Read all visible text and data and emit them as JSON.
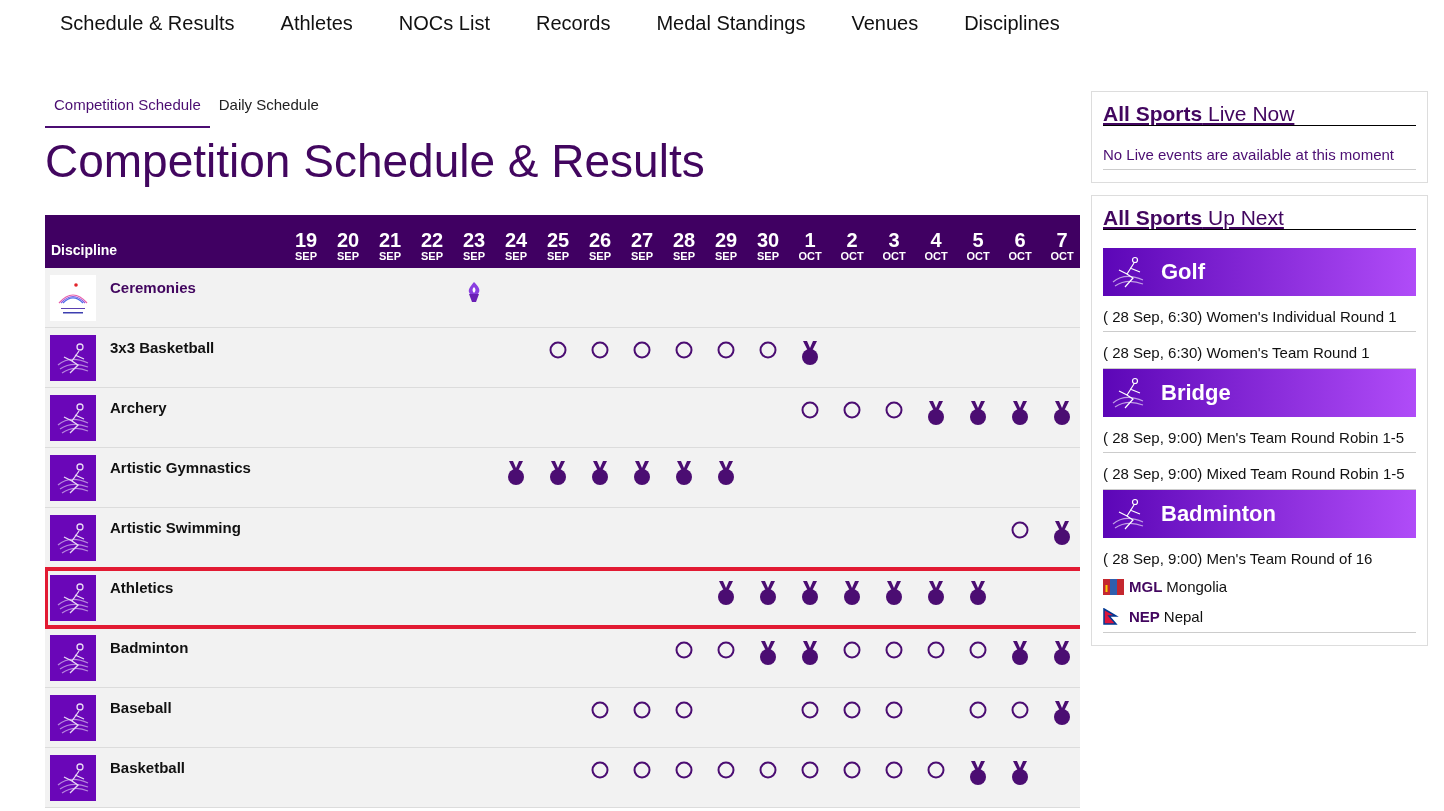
{
  "nav": [
    "Schedule & Results",
    "Athletes",
    "NOCs List",
    "Records",
    "Medal Standings",
    "Venues",
    "Disciplines"
  ],
  "tabs": [
    {
      "label": "Competition Schedule",
      "selected": true
    },
    {
      "label": "Daily Schedule",
      "selected": false
    }
  ],
  "title": "Competition Schedule & Results",
  "table": {
    "discipline_header": "Discipline",
    "days": [
      {
        "day": "19",
        "month": "SEP"
      },
      {
        "day": "20",
        "month": "SEP"
      },
      {
        "day": "21",
        "month": "SEP"
      },
      {
        "day": "22",
        "month": "SEP"
      },
      {
        "day": "23",
        "month": "SEP"
      },
      {
        "day": "24",
        "month": "SEP"
      },
      {
        "day": "25",
        "month": "SEP"
      },
      {
        "day": "26",
        "month": "SEP"
      },
      {
        "day": "27",
        "month": "SEP"
      },
      {
        "day": "28",
        "month": "SEP"
      },
      {
        "day": "29",
        "month": "SEP"
      },
      {
        "day": "30",
        "month": "SEP"
      },
      {
        "day": "1",
        "month": "OCT"
      },
      {
        "day": "2",
        "month": "OCT"
      },
      {
        "day": "3",
        "month": "OCT"
      },
      {
        "day": "4",
        "month": "OCT"
      },
      {
        "day": "5",
        "month": "OCT"
      },
      {
        "day": "6",
        "month": "OCT"
      },
      {
        "day": "7",
        "month": "OCT"
      }
    ],
    "rows": [
      {
        "name": "Ceremonies",
        "kind": "ceremony",
        "highlighted": false,
        "cells": [
          {
            "kind": "none"
          },
          {
            "kind": "none"
          },
          {
            "kind": "none"
          },
          {
            "kind": "none"
          },
          {
            "kind": "ceremony"
          },
          {
            "kind": "none"
          },
          {
            "kind": "none"
          },
          {
            "kind": "none"
          },
          {
            "kind": "none"
          },
          {
            "kind": "none"
          },
          {
            "kind": "none"
          },
          {
            "kind": "none"
          },
          {
            "kind": "none"
          },
          {
            "kind": "none"
          },
          {
            "kind": "none"
          },
          {
            "kind": "none"
          },
          {
            "kind": "none"
          },
          {
            "kind": "none"
          },
          {
            "kind": "none"
          }
        ]
      },
      {
        "name": "3x3 Basketball",
        "kind": "sport",
        "highlighted": false,
        "cells": [
          {
            "kind": "none"
          },
          {
            "kind": "none"
          },
          {
            "kind": "none"
          },
          {
            "kind": "none"
          },
          {
            "kind": "none"
          },
          {
            "kind": "none"
          },
          {
            "kind": "event"
          },
          {
            "kind": "event"
          },
          {
            "kind": "event"
          },
          {
            "kind": "event"
          },
          {
            "kind": "event"
          },
          {
            "kind": "event"
          },
          {
            "kind": "medal"
          },
          {
            "kind": "none"
          },
          {
            "kind": "none"
          },
          {
            "kind": "none"
          },
          {
            "kind": "none"
          },
          {
            "kind": "none"
          },
          {
            "kind": "none"
          }
        ]
      },
      {
        "name": "Archery",
        "kind": "sport",
        "highlighted": false,
        "cells": [
          {
            "kind": "none"
          },
          {
            "kind": "none"
          },
          {
            "kind": "none"
          },
          {
            "kind": "none"
          },
          {
            "kind": "none"
          },
          {
            "kind": "none"
          },
          {
            "kind": "none"
          },
          {
            "kind": "none"
          },
          {
            "kind": "none"
          },
          {
            "kind": "none"
          },
          {
            "kind": "none"
          },
          {
            "kind": "none"
          },
          {
            "kind": "event"
          },
          {
            "kind": "event"
          },
          {
            "kind": "event"
          },
          {
            "kind": "medal"
          },
          {
            "kind": "medal"
          },
          {
            "kind": "medal"
          },
          {
            "kind": "medal"
          }
        ]
      },
      {
        "name": "Artistic Gymnastics",
        "kind": "sport",
        "highlighted": false,
        "cells": [
          {
            "kind": "none"
          },
          {
            "kind": "none"
          },
          {
            "kind": "none"
          },
          {
            "kind": "none"
          },
          {
            "kind": "none"
          },
          {
            "kind": "medal"
          },
          {
            "kind": "medal"
          },
          {
            "kind": "medal"
          },
          {
            "kind": "medal"
          },
          {
            "kind": "medal"
          },
          {
            "kind": "medal"
          },
          {
            "kind": "none"
          },
          {
            "kind": "none"
          },
          {
            "kind": "none"
          },
          {
            "kind": "none"
          },
          {
            "kind": "none"
          },
          {
            "kind": "none"
          },
          {
            "kind": "none"
          },
          {
            "kind": "none"
          }
        ]
      },
      {
        "name": "Artistic Swimming",
        "kind": "sport",
        "highlighted": false,
        "cells": [
          {
            "kind": "none"
          },
          {
            "kind": "none"
          },
          {
            "kind": "none"
          },
          {
            "kind": "none"
          },
          {
            "kind": "none"
          },
          {
            "kind": "none"
          },
          {
            "kind": "none"
          },
          {
            "kind": "none"
          },
          {
            "kind": "none"
          },
          {
            "kind": "none"
          },
          {
            "kind": "none"
          },
          {
            "kind": "none"
          },
          {
            "kind": "none"
          },
          {
            "kind": "none"
          },
          {
            "kind": "none"
          },
          {
            "kind": "none"
          },
          {
            "kind": "none"
          },
          {
            "kind": "event"
          },
          {
            "kind": "medal"
          }
        ]
      },
      {
        "name": "Athletics",
        "kind": "sport",
        "highlighted": true,
        "cells": [
          {
            "kind": "none"
          },
          {
            "kind": "none"
          },
          {
            "kind": "none"
          },
          {
            "kind": "none"
          },
          {
            "kind": "none"
          },
          {
            "kind": "none"
          },
          {
            "kind": "none"
          },
          {
            "kind": "none"
          },
          {
            "kind": "none"
          },
          {
            "kind": "none"
          },
          {
            "kind": "medal"
          },
          {
            "kind": "medal"
          },
          {
            "kind": "medal"
          },
          {
            "kind": "medal"
          },
          {
            "kind": "medal"
          },
          {
            "kind": "medal"
          },
          {
            "kind": "medal"
          },
          {
            "kind": "none"
          },
          {
            "kind": "none"
          }
        ]
      },
      {
        "name": "Badminton",
        "kind": "sport",
        "highlighted": false,
        "cells": [
          {
            "kind": "none"
          },
          {
            "kind": "none"
          },
          {
            "kind": "none"
          },
          {
            "kind": "none"
          },
          {
            "kind": "none"
          },
          {
            "kind": "none"
          },
          {
            "kind": "none"
          },
          {
            "kind": "none"
          },
          {
            "kind": "none"
          },
          {
            "kind": "event"
          },
          {
            "kind": "event"
          },
          {
            "kind": "medal"
          },
          {
            "kind": "medal"
          },
          {
            "kind": "event"
          },
          {
            "kind": "event"
          },
          {
            "kind": "event"
          },
          {
            "kind": "event"
          },
          {
            "kind": "medal"
          },
          {
            "kind": "medal"
          }
        ]
      },
      {
        "name": "Baseball",
        "kind": "sport",
        "highlighted": false,
        "cells": [
          {
            "kind": "none"
          },
          {
            "kind": "none"
          },
          {
            "kind": "none"
          },
          {
            "kind": "none"
          },
          {
            "kind": "none"
          },
          {
            "kind": "none"
          },
          {
            "kind": "none"
          },
          {
            "kind": "event"
          },
          {
            "kind": "event"
          },
          {
            "kind": "event"
          },
          {
            "kind": "none"
          },
          {
            "kind": "none"
          },
          {
            "kind": "event"
          },
          {
            "kind": "event"
          },
          {
            "kind": "event"
          },
          {
            "kind": "none"
          },
          {
            "kind": "event"
          },
          {
            "kind": "event"
          },
          {
            "kind": "medal"
          }
        ]
      },
      {
        "name": "Basketball",
        "kind": "sport",
        "highlighted": false,
        "cells": [
          {
            "kind": "none"
          },
          {
            "kind": "none"
          },
          {
            "kind": "none"
          },
          {
            "kind": "none"
          },
          {
            "kind": "none"
          },
          {
            "kind": "none"
          },
          {
            "kind": "none"
          },
          {
            "kind": "event"
          },
          {
            "kind": "event"
          },
          {
            "kind": "event"
          },
          {
            "kind": "event"
          },
          {
            "kind": "event"
          },
          {
            "kind": "event"
          },
          {
            "kind": "event"
          },
          {
            "kind": "event"
          },
          {
            "kind": "event"
          },
          {
            "kind": "medal"
          },
          {
            "kind": "medal"
          },
          {
            "kind": "none"
          }
        ]
      }
    ]
  },
  "live_now": {
    "heading": "**All Sports** Live Now",
    "message": "No Live events are available at this moment"
  },
  "up_next": {
    "heading": "**All Sports** Up Next",
    "sports": [
      {
        "name": "Golf",
        "events": [
          "( 28 Sep, 6:30) Women's Individual Round 1",
          "( 28 Sep, 6:30) Women's Team Round 1"
        ]
      },
      {
        "name": "Bridge",
        "events": [
          "( 28 Sep, 9:00) Men's Team Round Robin 1-5",
          "( 28 Sep, 9:00) Mixed Team Round Robin 1-5"
        ]
      },
      {
        "name": "Badminton",
        "events": [
          "( 28 Sep, 9:00) Men's Team Round of 16"
        ],
        "participants": [
          {
            "code": "MGL",
            "country": "Mongolia",
            "kind": "tricolor"
          },
          {
            "code": "NEP",
            "country": "Nepal",
            "kind": "pennant"
          }
        ]
      }
    ]
  }
}
